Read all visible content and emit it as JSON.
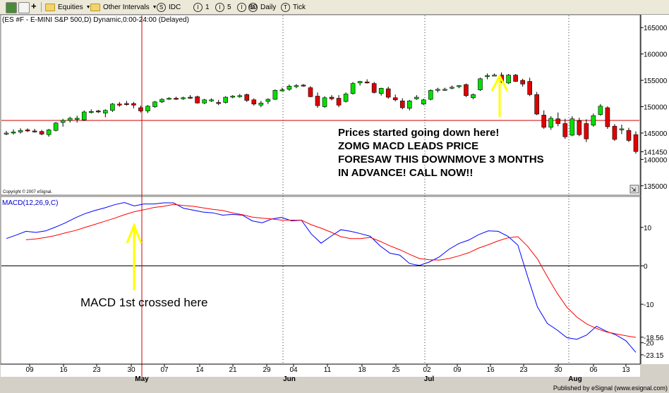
{
  "toolbar": {
    "equities_label": "Equities",
    "intervals_label": "Other Intervals",
    "idc_label": "IDC",
    "idc_symbol": "S",
    "i1_label": "1",
    "i5_label": "5",
    "i60_label": "60",
    "daily_label": "Daily",
    "tick_label": "Tick",
    "i_symbol": "I",
    "d_symbol": "D",
    "t_symbol": "T"
  },
  "chart_title": "(ES #F - E-MINI S&P 500,D) Dynamic,0:00-24:00 (Delayed)",
  "copyright": "Copyright © 2007 eSignal.",
  "footer_brand": "Published by eSignal (www.esignal.com)",
  "colors": {
    "up": "#00e000",
    "down": "#e00000",
    "macd": "#0000ff",
    "signal": "#ff0000",
    "annot": "#000000",
    "arrow": "#ffff00",
    "crosshair": "#cc0000",
    "bg": "#ffffff"
  },
  "annotations": {
    "prices": [
      "Prices started going down here!",
      "ZOMG MACD LEADS PRICE",
      "FORESAW THIS DOWNMOVE 3 MONTHS",
      "IN ADVANCE! CALL NOW!!"
    ],
    "macd": "MACD 1st crossed here"
  },
  "chart_data": [
    {
      "type": "candlestick",
      "title": "(ES #F - E-MINI S&P 500,D) Dynamic,0:00-24:00 (Delayed)",
      "y_ticks": [
        "165000",
        "160000",
        "155000",
        "150000",
        "145000",
        "141450",
        "140000",
        "135000"
      ],
      "y_tick_values": [
        165000,
        160000,
        155000,
        150000,
        145000,
        141450,
        140000,
        135000
      ],
      "ylim": [
        133500,
        166500
      ],
      "x_tick_labels": [
        "09",
        "16",
        "23",
        "30",
        "07",
        "14",
        "21",
        "29",
        "04",
        "11",
        "18",
        "25",
        "02",
        "09",
        "16",
        "23",
        "30",
        "06",
        "13"
      ],
      "month_labels": [
        "May",
        "Jun",
        "Jul",
        "Aug"
      ],
      "crosshair_price": 147400,
      "candles": [
        {
          "o": 144900,
          "h": 145400,
          "l": 144600,
          "c": 145000
        },
        {
          "o": 145100,
          "h": 145700,
          "l": 144700,
          "c": 145200
        },
        {
          "o": 145200,
          "h": 145900,
          "l": 144900,
          "c": 145500
        },
        {
          "o": 145600,
          "h": 145900,
          "l": 145200,
          "c": 145400
        },
        {
          "o": 145400,
          "h": 145800,
          "l": 145100,
          "c": 145300
        },
        {
          "o": 145300,
          "h": 145600,
          "l": 144600,
          "c": 144800
        },
        {
          "o": 144700,
          "h": 145800,
          "l": 144300,
          "c": 145600
        },
        {
          "o": 145500,
          "h": 147100,
          "l": 145300,
          "c": 146900
        },
        {
          "o": 147000,
          "h": 147700,
          "l": 146200,
          "c": 147400
        },
        {
          "o": 147400,
          "h": 148100,
          "l": 147000,
          "c": 147800
        },
        {
          "o": 147600,
          "h": 148300,
          "l": 147000,
          "c": 147800
        },
        {
          "o": 147500,
          "h": 149300,
          "l": 147300,
          "c": 149000
        },
        {
          "o": 149000,
          "h": 149500,
          "l": 148700,
          "c": 149100
        },
        {
          "o": 149200,
          "h": 149400,
          "l": 148800,
          "c": 149000
        },
        {
          "o": 148800,
          "h": 149500,
          "l": 148000,
          "c": 149300
        },
        {
          "o": 149300,
          "h": 150700,
          "l": 149000,
          "c": 150500
        },
        {
          "o": 150500,
          "h": 150900,
          "l": 150000,
          "c": 150400
        },
        {
          "o": 150600,
          "h": 151100,
          "l": 150200,
          "c": 150500
        },
        {
          "o": 150600,
          "h": 150900,
          "l": 149700,
          "c": 150300
        },
        {
          "o": 149800,
          "h": 150200,
          "l": 148900,
          "c": 149200
        },
        {
          "o": 149200,
          "h": 150300,
          "l": 148800,
          "c": 150100
        },
        {
          "o": 150000,
          "h": 151100,
          "l": 149800,
          "c": 150900
        },
        {
          "o": 150900,
          "h": 151600,
          "l": 150700,
          "c": 151400
        },
        {
          "o": 151500,
          "h": 151800,
          "l": 151300,
          "c": 151600
        },
        {
          "o": 151600,
          "h": 151900,
          "l": 151300,
          "c": 151500
        },
        {
          "o": 151600,
          "h": 151900,
          "l": 151300,
          "c": 151700
        },
        {
          "o": 151800,
          "h": 152200,
          "l": 151500,
          "c": 151700
        },
        {
          "o": 151900,
          "h": 152100,
          "l": 150600,
          "c": 150700
        },
        {
          "o": 150700,
          "h": 151500,
          "l": 150500,
          "c": 151300
        },
        {
          "o": 151200,
          "h": 151600,
          "l": 150900,
          "c": 151300
        },
        {
          "o": 150800,
          "h": 151300,
          "l": 150300,
          "c": 150700
        },
        {
          "o": 150800,
          "h": 152000,
          "l": 150600,
          "c": 151800
        },
        {
          "o": 151900,
          "h": 152200,
          "l": 151600,
          "c": 152000
        },
        {
          "o": 152100,
          "h": 152400,
          "l": 151700,
          "c": 152100
        },
        {
          "o": 152300,
          "h": 152500,
          "l": 150900,
          "c": 151200
        },
        {
          "o": 151300,
          "h": 151600,
          "l": 150200,
          "c": 150500
        },
        {
          "o": 150300,
          "h": 151100,
          "l": 149900,
          "c": 150700
        },
        {
          "o": 151000,
          "h": 151600,
          "l": 150500,
          "c": 151400
        },
        {
          "o": 151400,
          "h": 153300,
          "l": 151300,
          "c": 153100
        },
        {
          "o": 153200,
          "h": 153600,
          "l": 152900,
          "c": 153200
        },
        {
          "o": 153300,
          "h": 154200,
          "l": 153000,
          "c": 153900
        },
        {
          "o": 153800,
          "h": 154300,
          "l": 153500,
          "c": 154000
        },
        {
          "o": 154100,
          "h": 154300,
          "l": 153800,
          "c": 154000
        },
        {
          "o": 153600,
          "h": 153900,
          "l": 151800,
          "c": 151900
        },
        {
          "o": 152000,
          "h": 152700,
          "l": 149800,
          "c": 150200
        },
        {
          "o": 150000,
          "h": 152000,
          "l": 149800,
          "c": 151700
        },
        {
          "o": 151800,
          "h": 152200,
          "l": 151200,
          "c": 151500
        },
        {
          "o": 151600,
          "h": 152200,
          "l": 149900,
          "c": 150300
        },
        {
          "o": 151000,
          "h": 152700,
          "l": 150800,
          "c": 152400
        },
        {
          "o": 152500,
          "h": 154700,
          "l": 152300,
          "c": 154400
        },
        {
          "o": 154500,
          "h": 154900,
          "l": 154000,
          "c": 154800
        },
        {
          "o": 154700,
          "h": 155200,
          "l": 154400,
          "c": 154500
        },
        {
          "o": 154400,
          "h": 154700,
          "l": 152500,
          "c": 152700
        },
        {
          "o": 152500,
          "h": 153600,
          "l": 152100,
          "c": 153500
        },
        {
          "o": 153400,
          "h": 153800,
          "l": 151500,
          "c": 151800
        },
        {
          "o": 151700,
          "h": 152300,
          "l": 151000,
          "c": 151300
        },
        {
          "o": 151100,
          "h": 151600,
          "l": 149500,
          "c": 149800
        },
        {
          "o": 149700,
          "h": 151300,
          "l": 149300,
          "c": 151100
        },
        {
          "o": 151500,
          "h": 152200,
          "l": 151300,
          "c": 151800
        },
        {
          "o": 150500,
          "h": 151500,
          "l": 150300,
          "c": 151300
        },
        {
          "o": 151400,
          "h": 153300,
          "l": 151200,
          "c": 153100
        },
        {
          "o": 153100,
          "h": 153600,
          "l": 152700,
          "c": 153300
        },
        {
          "o": 153300,
          "h": 153600,
          "l": 153000,
          "c": 153300
        },
        {
          "o": 153600,
          "h": 154000,
          "l": 153300,
          "c": 153700
        },
        {
          "o": 153800,
          "h": 154100,
          "l": 153500,
          "c": 154000
        },
        {
          "o": 154200,
          "h": 154400,
          "l": 151800,
          "c": 152100
        },
        {
          "o": 151700,
          "h": 152500,
          "l": 151400,
          "c": 152300
        },
        {
          "o": 153200,
          "h": 155500,
          "l": 153000,
          "c": 155300
        },
        {
          "o": 155800,
          "h": 156300,
          "l": 155200,
          "c": 155900
        },
        {
          "o": 156000,
          "h": 156300,
          "l": 155800,
          "c": 156000
        },
        {
          "o": 156000,
          "h": 156500,
          "l": 154500,
          "c": 154700
        },
        {
          "o": 154500,
          "h": 156200,
          "l": 154300,
          "c": 156000
        },
        {
          "o": 156000,
          "h": 156200,
          "l": 154700,
          "c": 154800
        },
        {
          "o": 155000,
          "h": 155300,
          "l": 153800,
          "c": 154300
        },
        {
          "o": 154800,
          "h": 155500,
          "l": 152000,
          "c": 152300
        },
        {
          "o": 152300,
          "h": 152800,
          "l": 148400,
          "c": 148600
        },
        {
          "o": 148400,
          "h": 149300,
          "l": 145800,
          "c": 146100
        },
        {
          "o": 146100,
          "h": 148200,
          "l": 145600,
          "c": 147800
        },
        {
          "o": 147700,
          "h": 148900,
          "l": 146300,
          "c": 146800
        },
        {
          "o": 146800,
          "h": 147700,
          "l": 143900,
          "c": 144300
        },
        {
          "o": 144600,
          "h": 148200,
          "l": 144400,
          "c": 147700
        },
        {
          "o": 147300,
          "h": 147900,
          "l": 144400,
          "c": 144700
        },
        {
          "o": 146800,
          "h": 147600,
          "l": 143300,
          "c": 143900
        },
        {
          "o": 146500,
          "h": 148700,
          "l": 146200,
          "c": 148300
        },
        {
          "o": 148500,
          "h": 150500,
          "l": 148300,
          "c": 150100
        },
        {
          "o": 149800,
          "h": 150100,
          "l": 145800,
          "c": 146200
        },
        {
          "o": 146300,
          "h": 146700,
          "l": 143500,
          "c": 143800
        },
        {
          "o": 145600,
          "h": 146600,
          "l": 144800,
          "c": 145800
        },
        {
          "o": 145500,
          "h": 146000,
          "l": 143300,
          "c": 143600
        },
        {
          "o": 144700,
          "h": 145300,
          "l": 141100,
          "c": 141500
        }
      ]
    },
    {
      "type": "line",
      "title": "MACD(12,26,9,C)",
      "y_ticks": [
        "10",
        "0",
        "-10",
        "-18.56",
        "-20",
        "-23.15"
      ],
      "y_tick_values": [
        10,
        0,
        -10,
        -18.56,
        -20,
        -23.15
      ],
      "ylim": [
        -25.2,
        17.5
      ],
      "zero_line": 0,
      "series": [
        {
          "name": "MACD",
          "values": [
            7.1,
            8.0,
            9.0,
            8.7,
            9.1,
            10.1,
            11.2,
            12.5,
            13.6,
            14.4,
            15.1,
            15.9,
            16.5,
            15.6,
            16.1,
            16.1,
            16.4,
            16.4,
            15.0,
            14.5,
            14.0,
            13.8,
            13.2,
            13.4,
            13.2,
            11.7,
            11.2,
            12.2,
            12.6,
            11.7,
            11.9,
            8.3,
            5.9,
            7.7,
            9.4,
            9.0,
            8.4,
            7.7,
            5.2,
            3.3,
            2.8,
            0.6,
            0.1,
            1.0,
            2.3,
            4.3,
            5.8,
            6.7,
            8.1,
            9.1,
            9.0,
            7.7,
            5.4,
            -2.8,
            -10.7,
            -15.0,
            -16.7,
            -18.7,
            -19.1,
            -18.0,
            -15.7,
            -17.0,
            -18.0,
            -19.5,
            -22.5
          ]
        },
        {
          "name": "Signal",
          "values": [
            null,
            null,
            6.8,
            7.0,
            7.4,
            7.9,
            8.6,
            9.2,
            10.0,
            10.8,
            11.6,
            12.4,
            13.3,
            14.1,
            14.6,
            15.2,
            15.5,
            16.0,
            15.7,
            15.5,
            15.1,
            14.7,
            14.4,
            13.8,
            13.3,
            12.7,
            12.4,
            12.2,
            11.9,
            11.9,
            11.9,
            10.7,
            9.8,
            8.8,
            7.6,
            7.1,
            7.1,
            7.4,
            6.4,
            5.2,
            4.2,
            3.0,
            1.9,
            1.6,
            1.5,
            1.9,
            2.6,
            3.4,
            4.6,
            5.5,
            6.5,
            7.3,
            7.6,
            5.1,
            1.8,
            -2.8,
            -7.1,
            -10.8,
            -13.3,
            -15.1,
            -16.3,
            -17.2,
            -17.7,
            -18.2,
            -18.6
          ]
        }
      ]
    }
  ]
}
